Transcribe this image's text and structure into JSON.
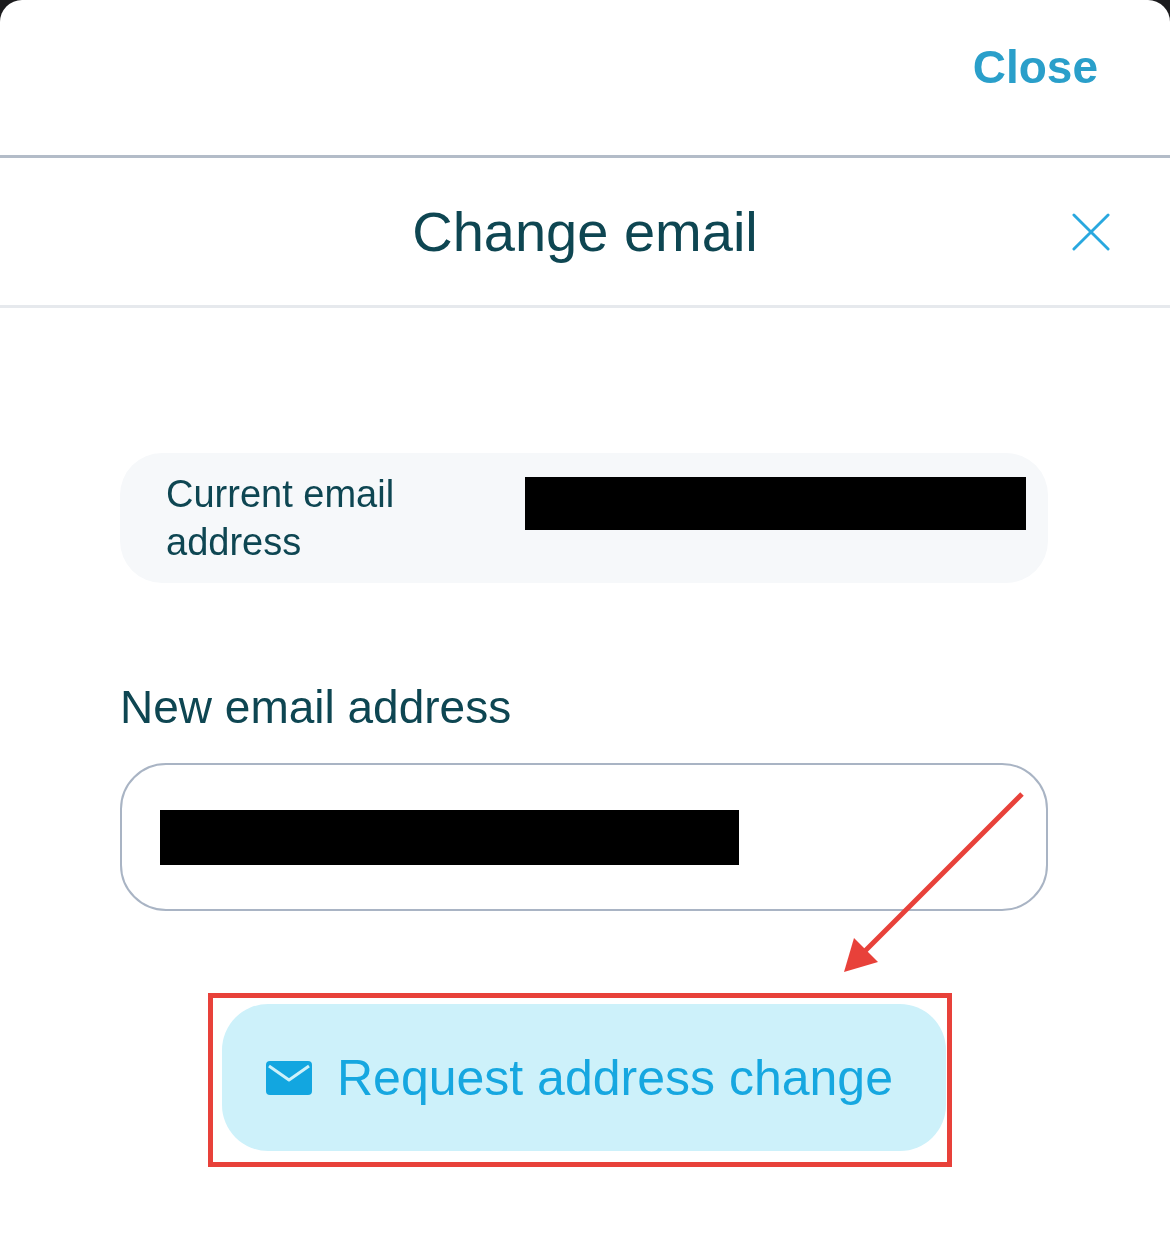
{
  "top_bar": {
    "close_label": "Close"
  },
  "dialog": {
    "title": "Change email"
  },
  "current_email": {
    "label": "Current email address",
    "value_redacted": true
  },
  "new_email": {
    "label": "New email address",
    "value_redacted": true
  },
  "submit_button": {
    "label": "Request address change"
  },
  "annotations": {
    "highlight_box": true,
    "arrow": true
  }
}
